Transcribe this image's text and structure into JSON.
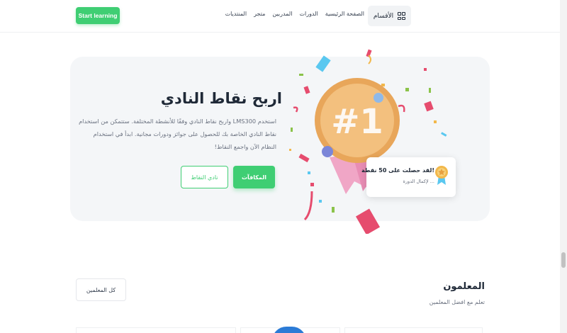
{
  "header": {
    "start_button": "Start learning",
    "nav": [
      "الصفحة الرئيسية",
      "الدورات",
      "المدربين",
      "متجر",
      "المنتديات"
    ],
    "categories_label": "الأقسام",
    "categories_icon": "grid-icon"
  },
  "promo": {
    "title": "اربح نقاط النادي",
    "description": "استخدم LMS300 واربح نقاط النادي وفقًا للأنشطة المختلفة. ستتمكن من استخدام نقاط النادي الخاصة بك للحصول على جوائز ودورات مجانية. ابدأ في استخدام النظام الآن واجمع النقاط!",
    "rewards_button": "المكافآت",
    "club_button": "نادي النقاط",
    "badge_text": "#1",
    "toast": {
      "title": "لقد حصلت على 50 نقطة!",
      "subtitle": "لإكمال الدورة ...",
      "icon": "medal-icon"
    }
  },
  "teachers": {
    "title": "المعلمون",
    "subtitle": "تعلم مع افضل المعلمين",
    "all_button": "كل المعلمين"
  },
  "colors": {
    "accent": "#3fce73",
    "card_bg": "#f4f6f8"
  }
}
